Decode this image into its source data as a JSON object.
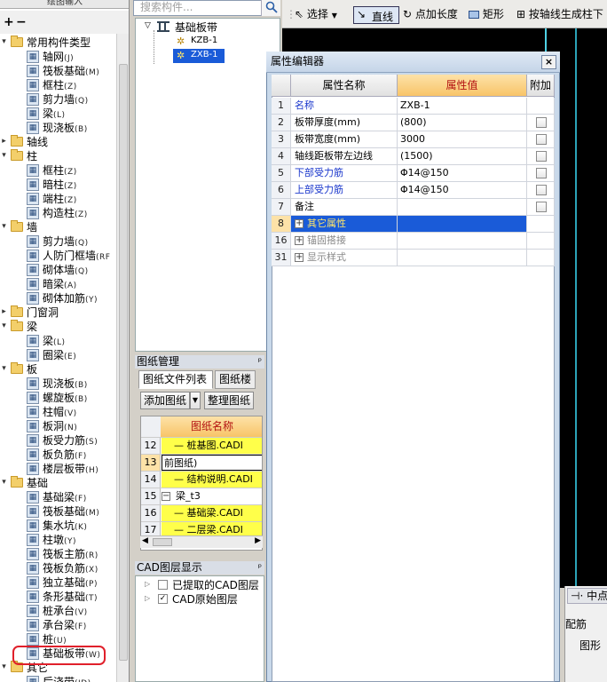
{
  "left_panel": {
    "title": "绘图输入",
    "toolbar": [
      "+",
      "−"
    ],
    "tree": [
      {
        "label": "常用构件类型",
        "level": 0,
        "type": "folder",
        "expanded": true
      },
      {
        "label": "轴网",
        "key": "(J)",
        "level": 1,
        "icon": "grid-icon"
      },
      {
        "label": "筏板基础",
        "key": "(M)",
        "level": 1,
        "icon": "raft-icon"
      },
      {
        "label": "框柱",
        "key": "(Z)",
        "level": 1,
        "icon": "column-icon"
      },
      {
        "label": "剪力墙",
        "key": "(Q)",
        "level": 1,
        "icon": "wall-icon"
      },
      {
        "label": "梁",
        "key": "(L)",
        "level": 1,
        "icon": "beam-icon"
      },
      {
        "label": "现浇板",
        "key": "(B)",
        "level": 1,
        "icon": "slab-icon"
      },
      {
        "label": "轴线",
        "level": 0,
        "type": "folder",
        "expanded": false
      },
      {
        "label": "柱",
        "level": 0,
        "type": "folder",
        "expanded": true
      },
      {
        "label": "框柱",
        "key": "(Z)",
        "level": 1,
        "icon": "column-icon"
      },
      {
        "label": "暗柱",
        "key": "(Z)",
        "level": 1,
        "icon": "column-icon"
      },
      {
        "label": "端柱",
        "key": "(Z)",
        "level": 1,
        "icon": "column-icon"
      },
      {
        "label": "构造柱",
        "key": "(Z)",
        "level": 1,
        "icon": "column-icon"
      },
      {
        "label": "墙",
        "level": 0,
        "type": "folder",
        "expanded": true
      },
      {
        "label": "剪力墙",
        "key": "(Q)",
        "level": 1,
        "icon": "wall-icon"
      },
      {
        "label": "人防门框墙",
        "key": "(RF",
        "level": 1,
        "icon": "door-frame-icon"
      },
      {
        "label": "砌体墙",
        "key": "(Q)",
        "level": 1,
        "icon": "masonry-icon"
      },
      {
        "label": "暗梁",
        "key": "(A)",
        "level": 1,
        "icon": "beam-icon"
      },
      {
        "label": "砌体加筋",
        "key": "(Y)",
        "level": 1,
        "icon": "rebar-icon"
      },
      {
        "label": "门窗洞",
        "level": 0,
        "type": "folder",
        "expanded": false
      },
      {
        "label": "梁",
        "level": 0,
        "type": "folder",
        "expanded": true
      },
      {
        "label": "梁",
        "key": "(L)",
        "level": 1,
        "icon": "beam-icon"
      },
      {
        "label": "圈梁",
        "key": "(E)",
        "level": 1,
        "icon": "ring-beam-icon"
      },
      {
        "label": "板",
        "level": 0,
        "type": "folder",
        "expanded": true
      },
      {
        "label": "现浇板",
        "key": "(B)",
        "level": 1,
        "icon": "slab-icon"
      },
      {
        "label": "螺旋板",
        "key": "(B)",
        "level": 1,
        "icon": "spiral-icon"
      },
      {
        "label": "柱帽",
        "key": "(V)",
        "level": 1,
        "icon": "cap-icon"
      },
      {
        "label": "板洞",
        "key": "(N)",
        "level": 1,
        "icon": "hole-icon"
      },
      {
        "label": "板受力筋",
        "key": "(S)",
        "level": 1,
        "icon": "rebar-icon"
      },
      {
        "label": "板负筋",
        "key": "(F)",
        "level": 1,
        "icon": "rebar-icon"
      },
      {
        "label": "楼层板带",
        "key": "(H)",
        "level": 1,
        "icon": "strip-icon"
      },
      {
        "label": "基础",
        "level": 0,
        "type": "folder",
        "expanded": true
      },
      {
        "label": "基础梁",
        "key": "(F)",
        "level": 1,
        "icon": "beam-icon"
      },
      {
        "label": "筏板基础",
        "key": "(M)",
        "level": 1,
        "icon": "raft-icon"
      },
      {
        "label": "集水坑",
        "key": "(K)",
        "level": 1,
        "icon": "pit-icon"
      },
      {
        "label": "柱墩",
        "key": "(Y)",
        "level": 1,
        "icon": "pier-icon"
      },
      {
        "label": "筏板主筋",
        "key": "(R)",
        "level": 1,
        "icon": "rebar-icon"
      },
      {
        "label": "筏板负筋",
        "key": "(X)",
        "level": 1,
        "icon": "rebar-icon"
      },
      {
        "label": "独立基础",
        "key": "(P)",
        "level": 1,
        "icon": "footing-icon"
      },
      {
        "label": "条形基础",
        "key": "(T)",
        "level": 1,
        "icon": "strip-footing-icon"
      },
      {
        "label": "桩承台",
        "key": "(V)",
        "level": 1,
        "icon": "pile-cap-icon"
      },
      {
        "label": "承台梁",
        "key": "(F)",
        "level": 1,
        "icon": "beam-icon"
      },
      {
        "label": "桩",
        "key": "(U)",
        "level": 1,
        "icon": "pile-icon"
      },
      {
        "label": "基础板带",
        "key": "(W)",
        "level": 1,
        "icon": "strip-icon",
        "highlighted": true
      },
      {
        "label": "其它",
        "level": 0,
        "type": "folder",
        "expanded": true
      },
      {
        "label": "后浇带",
        "key": "(JD)",
        "level": 1,
        "icon": "strip-icon"
      }
    ]
  },
  "middle_panel": {
    "search_placeholder": "搜索构件...",
    "component_tree": {
      "root": "基础板带",
      "items": [
        "KZB-1",
        "ZXB-1"
      ],
      "selected": "ZXB-1"
    },
    "drawing_panel": {
      "title": "图纸管理",
      "tabs": [
        "图纸文件列表",
        "图纸楼"
      ],
      "buttons": [
        "添加图纸",
        "整理图纸"
      ],
      "column_header": "图纸名称",
      "rows": [
        {
          "num": "12",
          "text": "— 桩基图.CADI",
          "style": "yellow"
        },
        {
          "num": "13",
          "text": "前图纸)",
          "style": "active"
        },
        {
          "num": "14",
          "text": "— 结构说明.CADI",
          "style": "yellow"
        },
        {
          "num": "15",
          "text": "梁_t3",
          "style": "group"
        },
        {
          "num": "16",
          "text": "— 基础梁.CADI",
          "style": "yellow"
        },
        {
          "num": "17",
          "text": "— 二层梁.CADI",
          "style": "yellow"
        }
      ]
    },
    "cad_layer_panel": {
      "title": "CAD图层显示",
      "layers": [
        {
          "label": "已提取的CAD图层",
          "checked": false
        },
        {
          "label": "CAD原始图层",
          "checked": true
        }
      ]
    }
  },
  "toolbar": {
    "select_label": "选择",
    "line_label": "直线",
    "point_length_label": "点加长度",
    "rect_label": "矩形",
    "axis_generate_label": "按轴线生成柱下"
  },
  "dialog": {
    "title": "属性编辑器",
    "close_label": "×",
    "headers": {
      "name": "属性名称",
      "value": "属性值",
      "extra": "附加"
    },
    "rows": [
      {
        "num": "1",
        "name": "名称",
        "value": "ZXB-1",
        "name_color": "blue",
        "has_check": false
      },
      {
        "num": "2",
        "name": "板带厚度(mm)",
        "value": "(800)",
        "name_color": "black",
        "has_check": true
      },
      {
        "num": "3",
        "name": "板带宽度(mm)",
        "value": "3000",
        "name_color": "black",
        "has_check": true
      },
      {
        "num": "4",
        "name": "轴线距板带左边线",
        "value": "(1500)",
        "name_color": "black",
        "has_check": true
      },
      {
        "num": "5",
        "name": "下部受力筋",
        "value": "Φ14@150",
        "name_color": "blue",
        "has_check": true
      },
      {
        "num": "6",
        "name": "上部受力筋",
        "value": "Φ14@150",
        "name_color": "blue",
        "has_check": true
      },
      {
        "num": "7",
        "name": "备注",
        "value": "",
        "name_color": "black",
        "has_check": true
      },
      {
        "num": "8",
        "name": "其它属性",
        "value": "",
        "name_color": "blue",
        "has_check": false,
        "group": true,
        "selected": true
      },
      {
        "num": "16",
        "name": "锚固搭接",
        "value": "",
        "name_color": "gray",
        "has_check": false,
        "group": true
      },
      {
        "num": "31",
        "name": "显示样式",
        "value": "",
        "name_color": "gray",
        "has_check": false,
        "group": true
      }
    ]
  },
  "bottom_right": {
    "midpoint_label": "中点",
    "rebar_label": "配筋",
    "shape_label": "图形"
  },
  "colors": {
    "highlight_ring": "#e0202b",
    "selected_item": "#1a5bd8",
    "yellow_row": "#ffff4a",
    "header_selected": "#f8c468",
    "canvas": "#000000"
  }
}
